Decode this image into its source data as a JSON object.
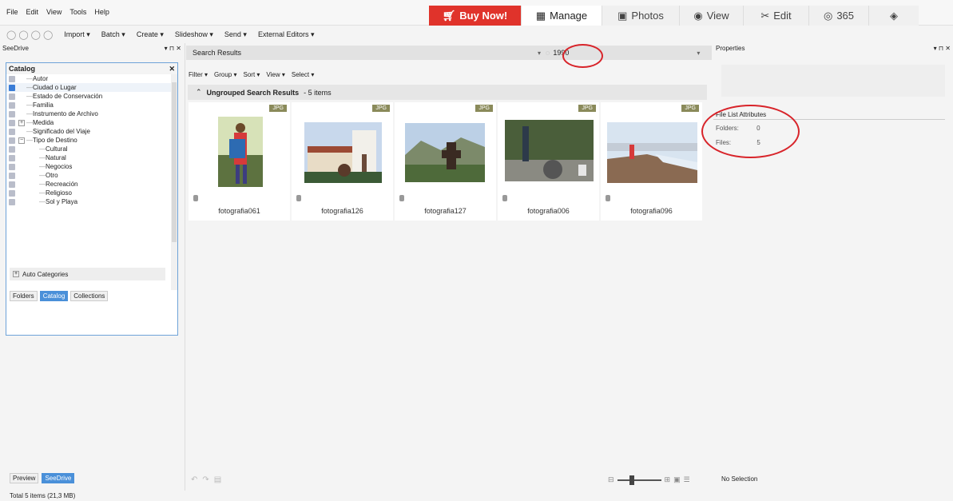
{
  "menu": [
    "File",
    "Edit",
    "View",
    "Tools",
    "Help"
  ],
  "modes": {
    "buy": "Buy Now!",
    "manage": "Manage",
    "photos": "Photos",
    "view": "View",
    "edit": "Edit",
    "y365": "365"
  },
  "toolbar": {
    "import": "Import ▾",
    "batch": "Batch ▾",
    "create": "Create ▾",
    "slideshow": "Slideshow ▾",
    "send": "Send ▾",
    "external": "External Editors ▾"
  },
  "left": {
    "panel_title": "SeeDrive",
    "catalog_title": "Catalog",
    "items": [
      {
        "label": "Autor",
        "indent": 1
      },
      {
        "label": "Ciudad o Lugar",
        "indent": 1
      },
      {
        "label": "Estado de Conservación",
        "indent": 1
      },
      {
        "label": "Familia",
        "indent": 1
      },
      {
        "label": "Instrumento de Archivo",
        "indent": 1
      },
      {
        "label": "Medida",
        "indent": 1,
        "exp": "+"
      },
      {
        "label": "Significado del Viaje",
        "indent": 1
      },
      {
        "label": "Tipo de Destino",
        "indent": 1,
        "exp": "−"
      },
      {
        "label": "Cultural",
        "indent": 2
      },
      {
        "label": "Natural",
        "indent": 2
      },
      {
        "label": "Negocios",
        "indent": 2
      },
      {
        "label": "Otro",
        "indent": 2
      },
      {
        "label": "Recreación",
        "indent": 2
      },
      {
        "label": "Religioso",
        "indent": 2
      },
      {
        "label": "Sol y Playa",
        "indent": 2
      }
    ],
    "auto_categories": "Auto Categories",
    "tabs": [
      "Folders",
      "Catalog",
      "Collections"
    ],
    "bottom_tabs": [
      "Preview",
      "SeeDrive"
    ]
  },
  "center": {
    "search_label": "Search Results",
    "search_value": "1990",
    "filters": [
      "Filter ▾",
      "Group ▾",
      "Sort ▾",
      "View ▾",
      "Select ▾"
    ],
    "group_title": "Ungrouped Search Results",
    "group_count": "- 5 items",
    "thumbs": [
      {
        "name": "fotografia061",
        "badge": "JPG"
      },
      {
        "name": "fotografia126",
        "badge": "JPG"
      },
      {
        "name": "fotografia127",
        "badge": "JPG"
      },
      {
        "name": "fotografia006",
        "badge": "JPG"
      },
      {
        "name": "fotografia096",
        "badge": "JPG"
      }
    ]
  },
  "right": {
    "title": "Properties",
    "attr_title": "File List Attributes",
    "folders_label": "Folders:",
    "folders_value": "0",
    "files_label": "Files:",
    "files_value": "5",
    "selection": "No Selection"
  },
  "status": "Total 5 items (21,3 MB)"
}
